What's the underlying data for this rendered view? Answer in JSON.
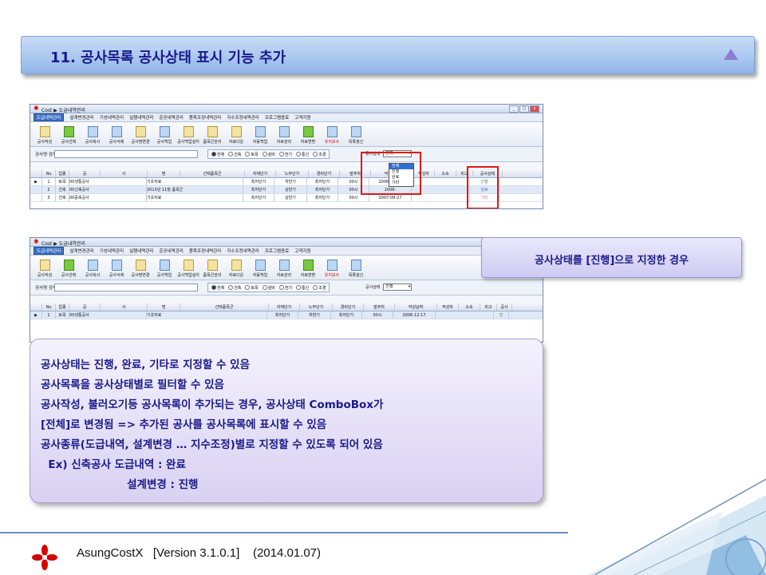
{
  "slide": {
    "title": "11. 공사목록 공사상태 표시 기능 추가"
  },
  "window": {
    "title": "Cost ▶ 도급내역관리",
    "menu": [
      "도급내역관리",
      "설계변경관리",
      "기성내역관리",
      "실행내역관리",
      "준공내역관리",
      "품목조정내역관리",
      "지수조정내역관리",
      "프로그램종료",
      "고객지원"
    ],
    "toolbar": [
      "공사작성",
      "공사선택",
      "공사복사",
      "공사삭제",
      "공사명변경",
      "공사백업",
      "공사백업설치",
      "품목군관리",
      "자료다운",
      "자동백업",
      "자료관리",
      "자료변환",
      "유지보수",
      "목록갱신"
    ],
    "search_label": "공사명 검색",
    "radios": [
      "전체",
      "건축",
      "토목",
      "설비",
      "전기",
      "통신",
      "조경"
    ],
    "status_label": "공사상태",
    "status_value_1": "전체",
    "status_value_2": "진행",
    "status_options": [
      "전체",
      "진행",
      "완료",
      "기타"
    ]
  },
  "grid1": {
    "headers": [
      "No",
      "업종",
      "공",
      "사",
      "명",
      "선택품목군",
      "자재단가",
      "노무단가",
      "경비단가",
      "발주처",
      "작성날짜",
      "작성자",
      "소속",
      "비고",
      "공사상태"
    ],
    "rows": [
      [
        "1",
        "토목",
        "00생통공사",
        "기초자료",
        "최저단가",
        "하반기",
        "최저단가",
        "00시",
        "2006-12-17",
        "진행"
      ],
      [
        "2",
        "건축",
        "00신축공사",
        "2013년 11월 품목군",
        "최저단가",
        "상반기",
        "최저단가",
        "00시",
        "2006-",
        "완료"
      ],
      [
        "3",
        "건축",
        "00증축공사",
        "기초자료",
        "최저단가",
        "상반기",
        "최저단가",
        "00시",
        "2007-09-27",
        "기타"
      ]
    ]
  },
  "grid2": {
    "headers": [
      "No",
      "업종",
      "공",
      "사",
      "명",
      "선택품목군",
      "자재단가",
      "노무단가",
      "경비단가",
      "발주처",
      "작성날짜",
      "작성자",
      "소속",
      "비고",
      "공사"
    ],
    "rows": [
      [
        "1",
        "토목",
        "00생통공사",
        "기초자료",
        "최저단가",
        "하반기",
        "최저단가",
        "00시",
        "2006-12-17",
        "진"
      ]
    ]
  },
  "callout": "공사상태를 [진행]으로 지정한 경우",
  "notes": [
    "공사상태는 진행, 완료, 기타로 지정할 수 있음",
    "공사목록을 공사상태별로 필터할 수 있음",
    "공사작성, 불러오기등 공사목록이 추가되는 경우,  공사상태 ComboBox가",
    "[전체]로 변경됨   =>  추가된 공사를 공사목록에 표시할 수 있음",
    "공사종류(도급내역, 설계변경 … 지수조정)별로 지정할 수 있도록 되어 있음",
    "  Ex) 신축공사 도급내역 : 완료",
    "                       설계변경 : 진행"
  ],
  "footer": "AsungCostX   [Version 3.1.0.1]    (2014.01.07)",
  "colors": {
    "accent": "#1a1a8a",
    "highlight": "#e01818",
    "status_progress": "#2e9a2e",
    "status_done": "#3b7bd4",
    "status_etc": "#d46aa0"
  }
}
